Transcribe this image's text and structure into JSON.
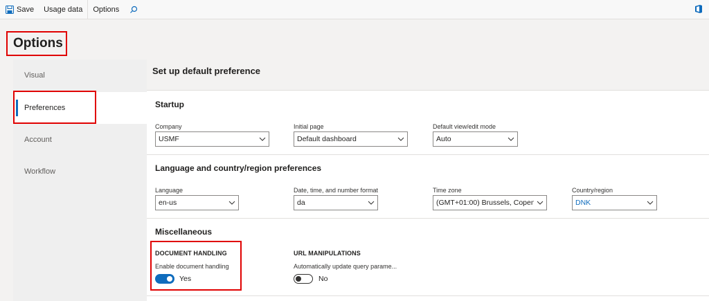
{
  "toolbar": {
    "save_label": "Save",
    "usage_label": "Usage data",
    "options_label": "Options"
  },
  "page_title": "Options",
  "nav": {
    "items": [
      {
        "label": "Visual"
      },
      {
        "label": "Preferences"
      },
      {
        "label": "Account"
      },
      {
        "label": "Workflow"
      }
    ],
    "selected": "Preferences"
  },
  "main": {
    "title": "Set up default preference",
    "startup": {
      "title": "Startup",
      "company": {
        "label": "Company",
        "value": "USMF"
      },
      "initial_page": {
        "label": "Initial page",
        "value": "Default dashboard"
      },
      "view_mode": {
        "label": "Default view/edit mode",
        "value": "Auto"
      }
    },
    "language": {
      "title": "Language and country/region preferences",
      "language": {
        "label": "Language",
        "value": "en-us"
      },
      "format": {
        "label": "Date, time, and number format",
        "value": "da"
      },
      "timezone": {
        "label": "Time zone",
        "value": "(GMT+01:00) Brussels, Copen..."
      },
      "country": {
        "label": "Country/region",
        "value": "DNK"
      }
    },
    "misc": {
      "title": "Miscellaneous",
      "doc_handling": {
        "group": "DOCUMENT HANDLING",
        "label": "Enable document handling",
        "state": "Yes"
      },
      "url_manip": {
        "group": "URL MANIPULATIONS",
        "label": "Automatically update query parame...",
        "state": "No"
      }
    }
  },
  "colors": {
    "accent": "#0f6cbd",
    "highlight": "#e00000"
  }
}
